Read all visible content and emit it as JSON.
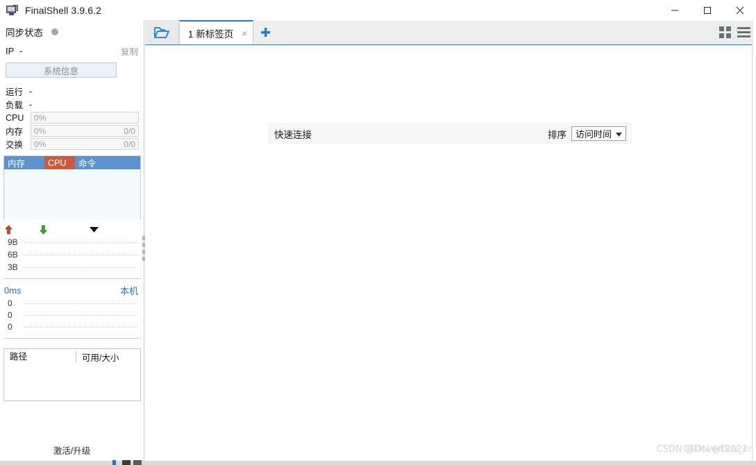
{
  "window": {
    "title": "FinalShell 3.9.6.2",
    "app_icon": "monitor-icon",
    "minimize_label": "—",
    "maximize_label": "□",
    "close_label": "✕"
  },
  "sidebar": {
    "sync": {
      "label": "同步状态",
      "status_icon": "status-dot",
      "status_color": "#a8a8a8"
    },
    "ip": {
      "key": "IP",
      "value": "-",
      "copy_label": "复制"
    },
    "system_info_button": "系统信息",
    "stats": [
      {
        "key": "运行",
        "value": "-",
        "type": "text"
      },
      {
        "key": "负载",
        "value": "-",
        "type": "text"
      },
      {
        "key": "CPU",
        "percent": "0%",
        "right": "",
        "type": "bar"
      },
      {
        "key": "内存",
        "percent": "0%",
        "right": "0/0",
        "type": "bar"
      },
      {
        "key": "交换",
        "percent": "0%",
        "right": "0/0",
        "type": "bar"
      }
    ],
    "process_table": {
      "columns": [
        {
          "label": "内存",
          "color": "#5d92cb"
        },
        {
          "label": "CPU",
          "color": "#ca5a40"
        },
        {
          "label": "命令",
          "color": "#5d92cb"
        }
      ],
      "rows": []
    },
    "network": {
      "upload_icon": "arrow-up-icon",
      "download_icon": "arrow-down-icon",
      "menu_icon": "caret-down-icon",
      "y_labels": [
        "9B",
        "6B",
        "3B"
      ]
    },
    "ping": {
      "latency": "0ms",
      "host": "本机",
      "y_labels": [
        "0",
        "0",
        "0"
      ]
    },
    "disks": {
      "columns": [
        "路径",
        "可用/大小"
      ],
      "rows": []
    },
    "activate_link": "激活/升级"
  },
  "main": {
    "tabbar": {
      "folder_icon": "open-folder-icon",
      "tabs": [
        {
          "label": "1 新标签页",
          "close_label": "×",
          "active": true
        }
      ],
      "add_tab_label": "+",
      "view_grid_icon": "grid-view-icon",
      "view_list_icon": "list-view-icon"
    },
    "quick_connect": {
      "title": "快速连接",
      "sort_label": "排序",
      "sort_value": "访问时间",
      "sort_caret": "▾"
    },
    "watermark": "CSDN @Dovert2021",
    "watermark_dup": "CSDN @Dov_ent2105"
  },
  "colors": {
    "accent": "#1d7fd4",
    "table_header": "#5d92cb",
    "cpu_highlight": "#ca5a40",
    "link": "#2a6fc9",
    "upload_arrow": "#c2511f",
    "download_arrow": "#2f9e2f"
  }
}
